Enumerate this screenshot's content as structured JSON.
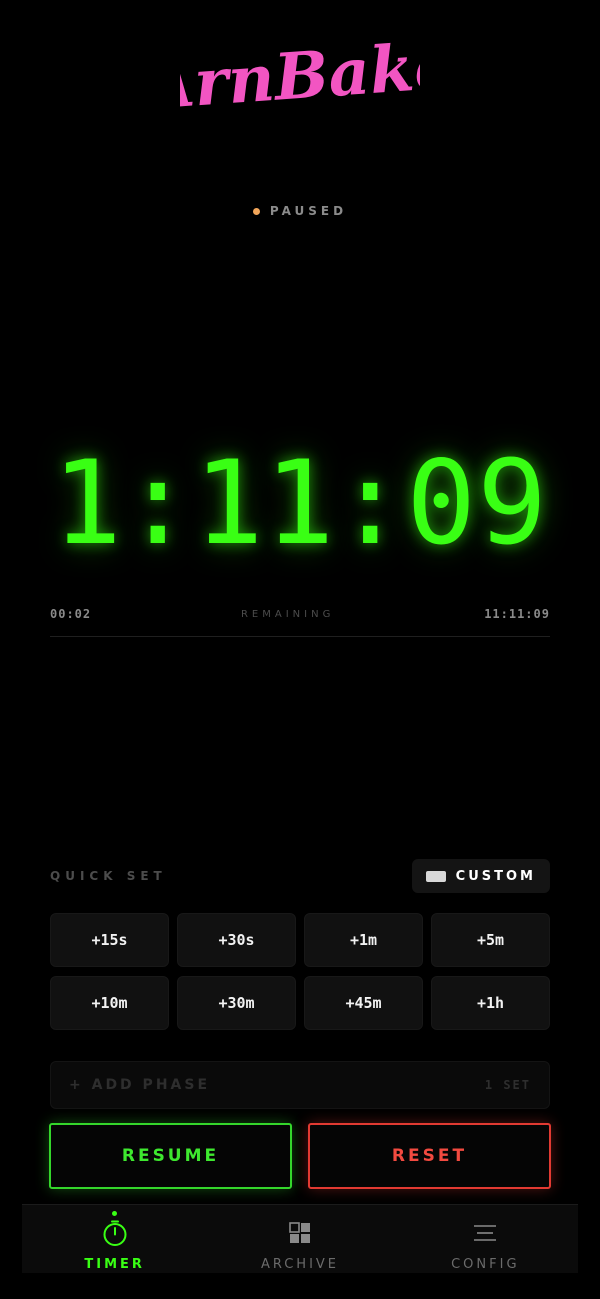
{
  "app": {
    "logo_text": "ArnBake"
  },
  "status": {
    "label": "PAUSED",
    "dot_color": "#f2a65a"
  },
  "timer": {
    "display": "1:11:09",
    "elapsed": "00:02",
    "remaining_label": "REMAINING",
    "total": "11:11:09",
    "color": "#39ff14"
  },
  "quick_set": {
    "label": "QUICK SET",
    "custom_label": "CUSTOM",
    "buttons": [
      "+15s",
      "+30s",
      "+1m",
      "+5m",
      "+10m",
      "+30m",
      "+45m",
      "+1h"
    ]
  },
  "phase": {
    "add_label": "+ ADD PHASE",
    "count": "1 SET"
  },
  "actions": {
    "resume": "RESUME",
    "reset": "RESET",
    "resume_color": "#34d62b",
    "reset_color": "#e23a32"
  },
  "tabs": [
    {
      "label": "TIMER",
      "icon": "stopwatch-icon",
      "active": true
    },
    {
      "label": "ARCHIVE",
      "icon": "grid-icon",
      "active": false
    },
    {
      "label": "CONFIG",
      "icon": "menu-lines-icon",
      "active": false
    }
  ]
}
